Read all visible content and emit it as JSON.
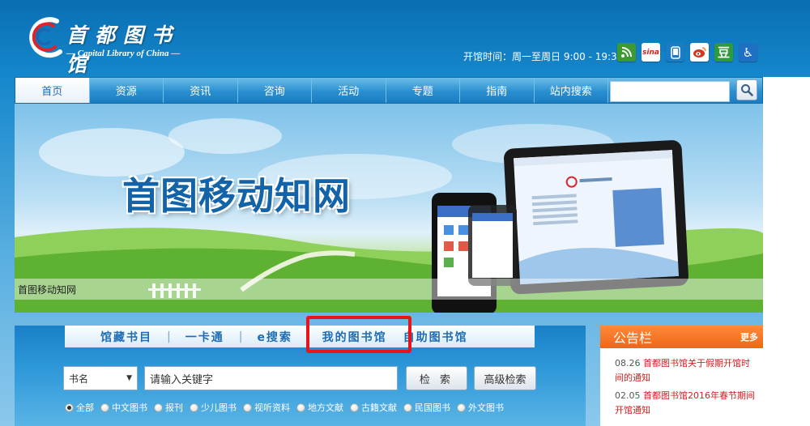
{
  "header": {
    "logo_cn": "首都图书馆",
    "logo_en": "— Capital Library of China —",
    "hours": "开馆时间：周一至周日 9:00 - 19:30",
    "social": [
      {
        "icon": "rss-icon",
        "glyph": "◉",
        "color": "#3c9a2f"
      },
      {
        "icon": "sina-icon",
        "glyph": "sina",
        "color": "#c9281c"
      },
      {
        "icon": "mobile-icon",
        "glyph": "▯",
        "color": "#1a7bc6"
      },
      {
        "icon": "weibo-icon",
        "glyph": "微",
        "color": "#d6361c"
      },
      {
        "icon": "douban-icon",
        "glyph": "豆",
        "color": "#2f9a3b"
      },
      {
        "icon": "accessibility-icon",
        "glyph": "♿",
        "color": "#1f6fc2"
      }
    ]
  },
  "nav": {
    "items": [
      "首页",
      "资源",
      "资讯",
      "咨询",
      "活动",
      "专题",
      "指南",
      "站内搜索"
    ],
    "search_placeholder": ""
  },
  "banner": {
    "title": "首图移动知网",
    "caption": "首图移动知网"
  },
  "search_panel": {
    "tabs": [
      "馆藏书目",
      "一卡通",
      "e搜索",
      "我的图书馆",
      "自助图书馆"
    ],
    "field_select": "书名",
    "keyword_placeholder": "请输入关键字",
    "search_button": "检 索",
    "advanced_button": "高级检索",
    "options": [
      "全部",
      "中文图书",
      "报刊",
      "少儿图书",
      "视听资料",
      "地方文献",
      "古籍文献",
      "民国图书",
      "外文图书"
    ]
  },
  "notice": {
    "title": "公告栏",
    "more": "更多",
    "items": [
      {
        "date": "08.26",
        "text": "首都图书馆关于假期开馆时间的通知"
      },
      {
        "date": "02.05",
        "text": "首都图书馆2016年春节期间开馆通知"
      }
    ]
  }
}
